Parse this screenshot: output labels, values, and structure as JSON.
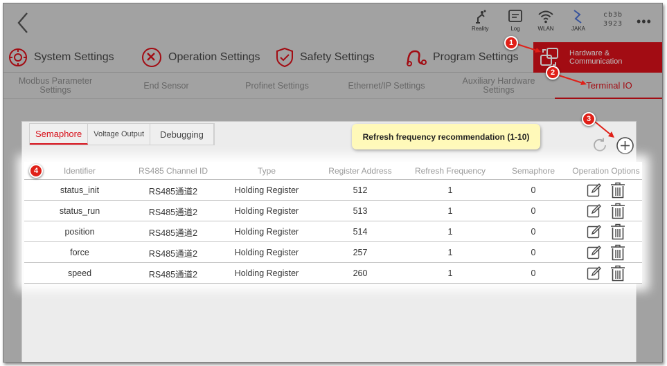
{
  "status_bar": {
    "reality_label": "Reality",
    "log_label": "Log",
    "wlan_label": "WLAN",
    "jaka_label": "JAKA",
    "device_id_line1": "cb3b",
    "device_id_line2": "3923",
    "more_icon": "more-icon"
  },
  "main_tabs": [
    {
      "label": "System Settings",
      "icon": "system-settings-icon"
    },
    {
      "label": "Operation Settings",
      "icon": "operation-settings-icon"
    },
    {
      "label": "Safety Settings",
      "icon": "safety-shield-icon"
    },
    {
      "label": "Program Settings",
      "icon": "program-settings-icon"
    },
    {
      "label": "Hardware & Communication",
      "icon": "hardware-icon",
      "active": true
    }
  ],
  "sub_tabs": [
    {
      "label": "Modbus Parameter Settings"
    },
    {
      "label": "End Sensor"
    },
    {
      "label": "Profinet Settings"
    },
    {
      "label": "Ethernet/IP Settings"
    },
    {
      "label": "Auxiliary Hardware Settings"
    },
    {
      "label": "Terminal IO",
      "active": true
    }
  ],
  "inner_tabs": [
    {
      "label": "Semaphore",
      "active": true
    },
    {
      "label": "Voltage Output"
    },
    {
      "label": "Debugging"
    }
  ],
  "tooltip": "Refresh frequency recommendation (1-10)",
  "table": {
    "headers": [
      "Identifier",
      "RS485 Channel ID",
      "Type",
      "Register Address",
      "Refresh Frequency",
      "Semaphore",
      "Operation Options"
    ],
    "rows": [
      [
        "status_init",
        "RS485通道2",
        "Holding Register",
        "512",
        "1",
        "0"
      ],
      [
        "status_run",
        "RS485通道2",
        "Holding Register",
        "513",
        "1",
        "0"
      ],
      [
        "position",
        "RS485通道2",
        "Holding Register",
        "514",
        "1",
        "0"
      ],
      [
        "force",
        "RS485通道2",
        "Holding Register",
        "257",
        "1",
        "0"
      ],
      [
        "speed",
        "RS485通道2",
        "Holding Register",
        "260",
        "1",
        "0"
      ]
    ]
  },
  "annotations": [
    "1",
    "2",
    "3",
    "4"
  ],
  "colors": {
    "accent": "#d8101a",
    "tooltip_bg": "#fff9b9",
    "badge": "#e02018"
  }
}
